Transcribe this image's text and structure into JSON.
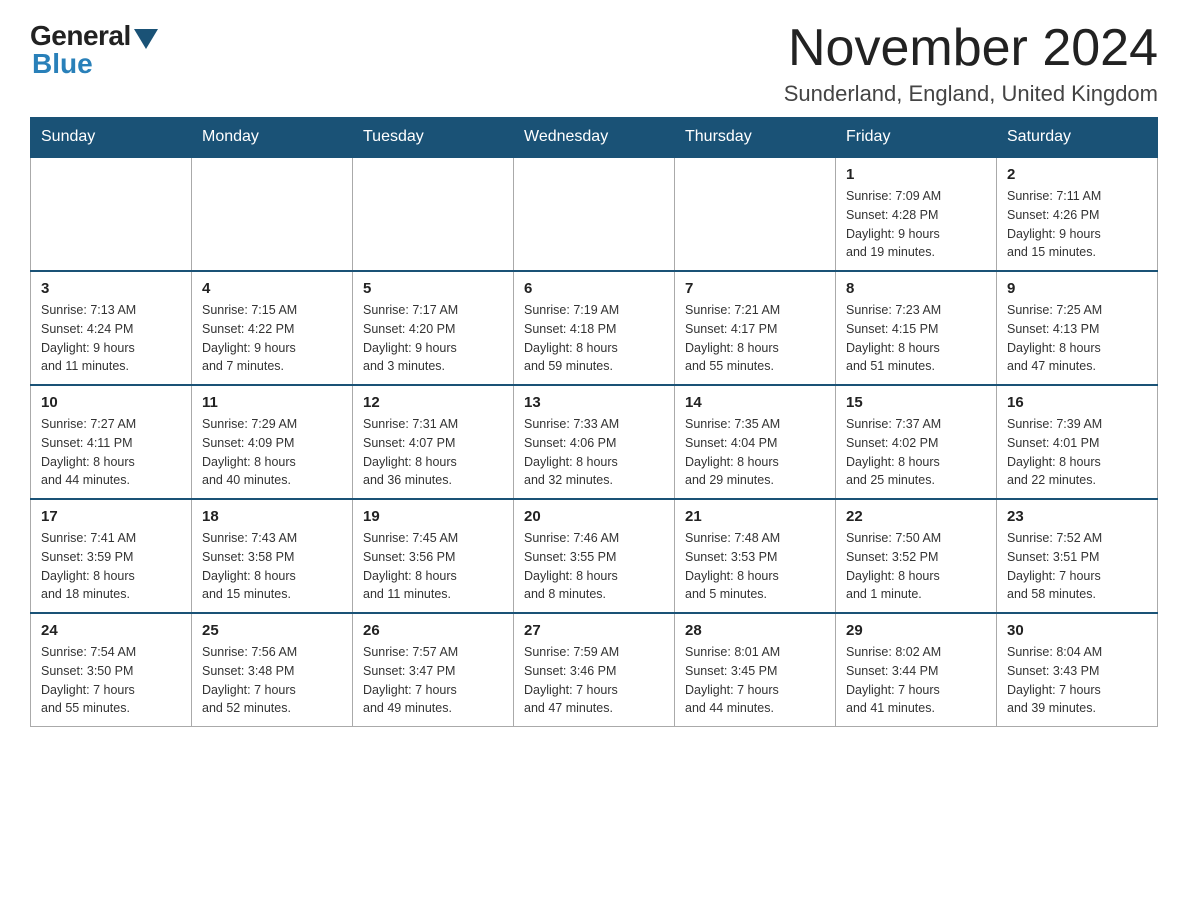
{
  "header": {
    "logo_general": "General",
    "logo_blue": "Blue",
    "month_title": "November 2024",
    "location": "Sunderland, England, United Kingdom"
  },
  "days_of_week": [
    "Sunday",
    "Monday",
    "Tuesday",
    "Wednesday",
    "Thursday",
    "Friday",
    "Saturday"
  ],
  "weeks": [
    [
      {
        "day": "",
        "info": ""
      },
      {
        "day": "",
        "info": ""
      },
      {
        "day": "",
        "info": ""
      },
      {
        "day": "",
        "info": ""
      },
      {
        "day": "",
        "info": ""
      },
      {
        "day": "1",
        "info": "Sunrise: 7:09 AM\nSunset: 4:28 PM\nDaylight: 9 hours\nand 19 minutes."
      },
      {
        "day": "2",
        "info": "Sunrise: 7:11 AM\nSunset: 4:26 PM\nDaylight: 9 hours\nand 15 minutes."
      }
    ],
    [
      {
        "day": "3",
        "info": "Sunrise: 7:13 AM\nSunset: 4:24 PM\nDaylight: 9 hours\nand 11 minutes."
      },
      {
        "day": "4",
        "info": "Sunrise: 7:15 AM\nSunset: 4:22 PM\nDaylight: 9 hours\nand 7 minutes."
      },
      {
        "day": "5",
        "info": "Sunrise: 7:17 AM\nSunset: 4:20 PM\nDaylight: 9 hours\nand 3 minutes."
      },
      {
        "day": "6",
        "info": "Sunrise: 7:19 AM\nSunset: 4:18 PM\nDaylight: 8 hours\nand 59 minutes."
      },
      {
        "day": "7",
        "info": "Sunrise: 7:21 AM\nSunset: 4:17 PM\nDaylight: 8 hours\nand 55 minutes."
      },
      {
        "day": "8",
        "info": "Sunrise: 7:23 AM\nSunset: 4:15 PM\nDaylight: 8 hours\nand 51 minutes."
      },
      {
        "day": "9",
        "info": "Sunrise: 7:25 AM\nSunset: 4:13 PM\nDaylight: 8 hours\nand 47 minutes."
      }
    ],
    [
      {
        "day": "10",
        "info": "Sunrise: 7:27 AM\nSunset: 4:11 PM\nDaylight: 8 hours\nand 44 minutes."
      },
      {
        "day": "11",
        "info": "Sunrise: 7:29 AM\nSunset: 4:09 PM\nDaylight: 8 hours\nand 40 minutes."
      },
      {
        "day": "12",
        "info": "Sunrise: 7:31 AM\nSunset: 4:07 PM\nDaylight: 8 hours\nand 36 minutes."
      },
      {
        "day": "13",
        "info": "Sunrise: 7:33 AM\nSunset: 4:06 PM\nDaylight: 8 hours\nand 32 minutes."
      },
      {
        "day": "14",
        "info": "Sunrise: 7:35 AM\nSunset: 4:04 PM\nDaylight: 8 hours\nand 29 minutes."
      },
      {
        "day": "15",
        "info": "Sunrise: 7:37 AM\nSunset: 4:02 PM\nDaylight: 8 hours\nand 25 minutes."
      },
      {
        "day": "16",
        "info": "Sunrise: 7:39 AM\nSunset: 4:01 PM\nDaylight: 8 hours\nand 22 minutes."
      }
    ],
    [
      {
        "day": "17",
        "info": "Sunrise: 7:41 AM\nSunset: 3:59 PM\nDaylight: 8 hours\nand 18 minutes."
      },
      {
        "day": "18",
        "info": "Sunrise: 7:43 AM\nSunset: 3:58 PM\nDaylight: 8 hours\nand 15 minutes."
      },
      {
        "day": "19",
        "info": "Sunrise: 7:45 AM\nSunset: 3:56 PM\nDaylight: 8 hours\nand 11 minutes."
      },
      {
        "day": "20",
        "info": "Sunrise: 7:46 AM\nSunset: 3:55 PM\nDaylight: 8 hours\nand 8 minutes."
      },
      {
        "day": "21",
        "info": "Sunrise: 7:48 AM\nSunset: 3:53 PM\nDaylight: 8 hours\nand 5 minutes."
      },
      {
        "day": "22",
        "info": "Sunrise: 7:50 AM\nSunset: 3:52 PM\nDaylight: 8 hours\nand 1 minute."
      },
      {
        "day": "23",
        "info": "Sunrise: 7:52 AM\nSunset: 3:51 PM\nDaylight: 7 hours\nand 58 minutes."
      }
    ],
    [
      {
        "day": "24",
        "info": "Sunrise: 7:54 AM\nSunset: 3:50 PM\nDaylight: 7 hours\nand 55 minutes."
      },
      {
        "day": "25",
        "info": "Sunrise: 7:56 AM\nSunset: 3:48 PM\nDaylight: 7 hours\nand 52 minutes."
      },
      {
        "day": "26",
        "info": "Sunrise: 7:57 AM\nSunset: 3:47 PM\nDaylight: 7 hours\nand 49 minutes."
      },
      {
        "day": "27",
        "info": "Sunrise: 7:59 AM\nSunset: 3:46 PM\nDaylight: 7 hours\nand 47 minutes."
      },
      {
        "day": "28",
        "info": "Sunrise: 8:01 AM\nSunset: 3:45 PM\nDaylight: 7 hours\nand 44 minutes."
      },
      {
        "day": "29",
        "info": "Sunrise: 8:02 AM\nSunset: 3:44 PM\nDaylight: 7 hours\nand 41 minutes."
      },
      {
        "day": "30",
        "info": "Sunrise: 8:04 AM\nSunset: 3:43 PM\nDaylight: 7 hours\nand 39 minutes."
      }
    ]
  ]
}
